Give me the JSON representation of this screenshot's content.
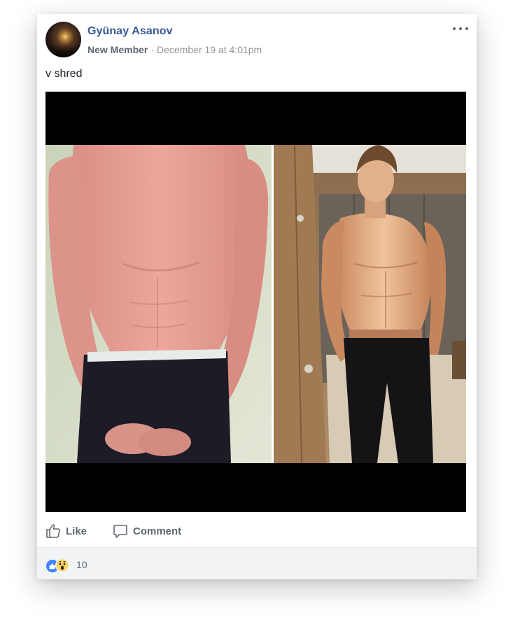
{
  "post": {
    "author": {
      "name": "Gyünay Asanov",
      "role": "New Member",
      "separator": "·",
      "timestamp": "December 19 at 4:01pm",
      "avatar_icon": "user-avatar"
    },
    "more_icon": "ellipsis-icon",
    "text": "v shred",
    "photo": {
      "description_icon": "photo"
    }
  },
  "actions": {
    "like_label": "Like",
    "comment_label": "Comment"
  },
  "reactions": {
    "types": [
      "like",
      "wow"
    ],
    "count": "10"
  },
  "colors": {
    "link_blue": "#385898",
    "meta_gray": "#90949c",
    "action_gray": "#606770",
    "reaction_bar_bg": "#f2f3f5",
    "like_blue": "#4080ff",
    "wow_yellow": "#fcd664"
  }
}
